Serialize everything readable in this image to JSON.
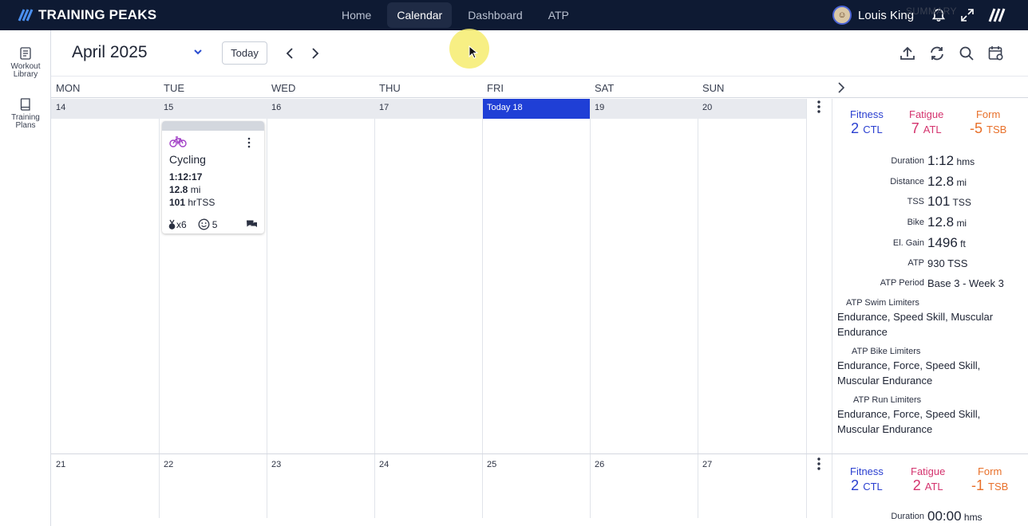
{
  "app": {
    "brand": "TRAINING PEAKS",
    "nav_tabs": [
      {
        "label": "Home"
      },
      {
        "label": "Calendar"
      },
      {
        "label": "Dashboard"
      },
      {
        "label": "ATP"
      }
    ],
    "user_name": "Louis King"
  },
  "sidebar": {
    "items": [
      {
        "label_line1": "Workout",
        "label_line2": "Library"
      },
      {
        "label_line1": "Training",
        "label_line2": "Plans"
      }
    ]
  },
  "toolbar": {
    "month": "April 2025",
    "today_label": "Today"
  },
  "calendar": {
    "day_names": [
      "MON",
      "TUE",
      "WED",
      "THU",
      "FRI",
      "SAT",
      "SUN"
    ],
    "summary_header": "SUMMARY",
    "week1": {
      "days": [
        "14",
        "15",
        "16",
        "17",
        "Today 18",
        "19",
        "20"
      ]
    },
    "week2": {
      "days": [
        "21",
        "22",
        "23",
        "24",
        "25",
        "26",
        "27"
      ]
    }
  },
  "workout": {
    "title": "Cycling",
    "duration": "1:12:17",
    "distance_value": "12.8",
    "distance_unit": "mi",
    "tss_value": "101",
    "tss_unit": "hrTSS",
    "medals": "x6",
    "feel": "5"
  },
  "summary1": {
    "fitness_label": "Fitness",
    "fitness_value": "2",
    "fitness_unit": "CTL",
    "fatigue_label": "Fatigue",
    "fatigue_value": "7",
    "fatigue_unit": "ATL",
    "form_label": "Form",
    "form_value": "-5",
    "form_unit": "TSB",
    "rows": [
      {
        "label": "Duration",
        "value": "1:12",
        "unit": "hms"
      },
      {
        "label": "Distance",
        "value": "12.8",
        "unit": "mi"
      },
      {
        "label": "TSS",
        "value": "101",
        "unit": "TSS"
      },
      {
        "label": "Bike",
        "value": "12.8",
        "unit": "mi"
      },
      {
        "label": "El. Gain",
        "value": "1496",
        "unit": "ft"
      },
      {
        "label": "ATP",
        "value": "930",
        "unit": "TSS"
      },
      {
        "label": "ATP Period",
        "value": "Base 3 - Week 3",
        "unit": ""
      }
    ],
    "swim_limiters_label": "ATP Swim Limiters",
    "swim_limiters": "Endurance, Speed Skill, Muscular Endurance",
    "bike_limiters_label": "ATP Bike Limiters",
    "bike_limiters": "Endurance, Force, Speed Skill, Muscular Endurance",
    "run_limiters_label": "ATP Run Limiters",
    "run_limiters": "Endurance, Force, Speed Skill, Muscular Endurance"
  },
  "summary2": {
    "fitness_label": "Fitness",
    "fitness_value": "2",
    "fitness_unit": "CTL",
    "fatigue_label": "Fatigue",
    "fatigue_value": "2",
    "fatigue_unit": "ATL",
    "form_label": "Form",
    "form_value": "-1",
    "form_unit": "TSB",
    "duration_label": "Duration",
    "duration_value": "00:00",
    "duration_unit": "hms"
  },
  "colors": {
    "fitness": "#2a3fd0",
    "fatigue": "#d4336e",
    "form": "#e8702a",
    "nav_bg": "#0e1a33",
    "today": "#1f3fd6"
  }
}
